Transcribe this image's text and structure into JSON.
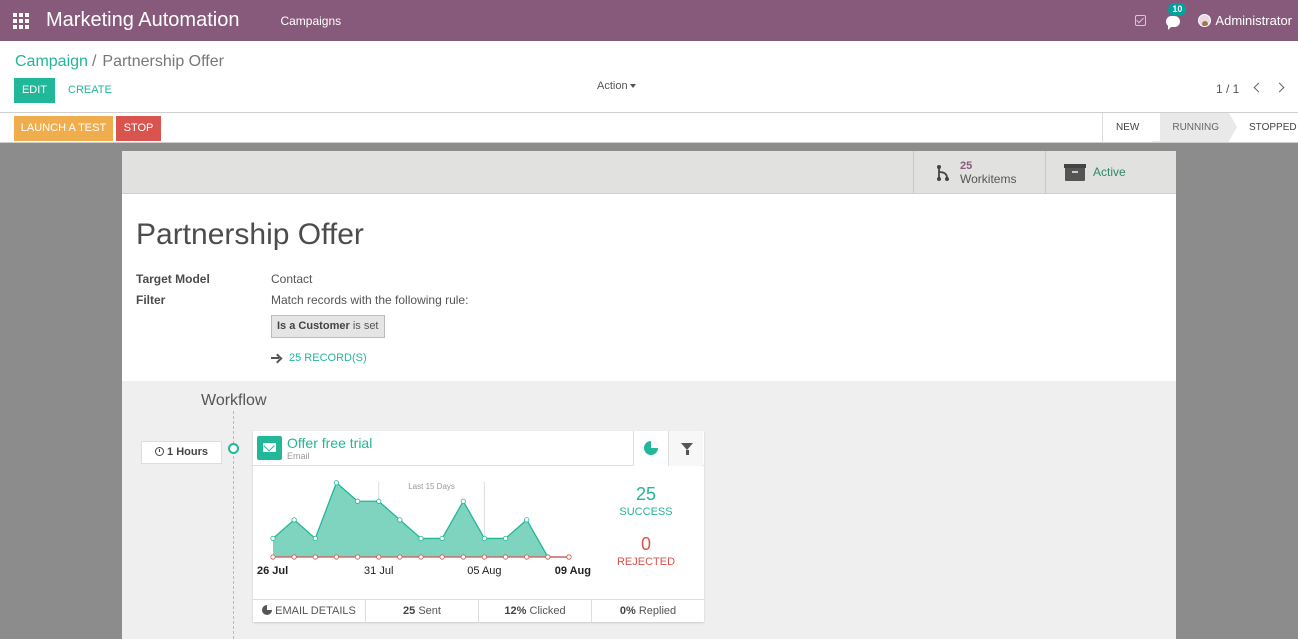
{
  "navbar": {
    "app_title": "Marketing Automation",
    "menu_campaigns": "Campaigns",
    "messages_badge": "10",
    "user_name": "Administrator"
  },
  "control": {
    "breadcrumb_parent": "Campaign",
    "breadcrumb_current": "Partnership Offer",
    "edit_label": "EDIT",
    "create_label": "CREATE",
    "action_label": "Action",
    "pager_text": "1 / 1"
  },
  "statusbar": {
    "launch_test_label": "LAUNCH A TEST",
    "stop_label": "STOP",
    "stages": [
      "NEW",
      "RUNNING",
      "STOPPED"
    ],
    "current_stage": "RUNNING"
  },
  "buttonbox": {
    "workitems_count": "25",
    "workitems_label": "Workitems",
    "active_label": "Active"
  },
  "record": {
    "title": "Partnership Offer",
    "target_model_label": "Target Model",
    "target_model_value": "Contact",
    "filter_label": "Filter",
    "filter_value": "Match records with the following rule:",
    "domain_field": "Is a Customer",
    "domain_operator": "is set",
    "records_link": "25 RECORD(S)"
  },
  "workflow": {
    "title": "Workflow",
    "interval_label": "1 Hours",
    "activity": {
      "name": "Offer free trial",
      "type": "Email",
      "success_count": "25",
      "success_label": "SUCCESS",
      "rejected_count": "0",
      "rejected_label": "REJECTED",
      "footer": {
        "details_label": "EMAIL DETAILS",
        "sent_value": "25",
        "sent_label": "Sent",
        "clicked_value": "12%",
        "clicked_label": "Clicked",
        "replied_value": "0%",
        "replied_label": "Replied"
      }
    }
  },
  "chart_data": {
    "type": "area",
    "annotation": "Last 15 Days",
    "x_tick_labels": [
      "26 Jul",
      "31 Jul",
      "05 Aug",
      "09 Aug"
    ],
    "series": [
      {
        "values": [
          1,
          2,
          1,
          4,
          3,
          3,
          2,
          1,
          1,
          3,
          1,
          1,
          2,
          0,
          0
        ],
        "color": "#21b799"
      },
      {
        "values": [
          0,
          0,
          0,
          0,
          0,
          0,
          0,
          0,
          0,
          0,
          0,
          0,
          0,
          0,
          0
        ],
        "color": "#d9534f"
      }
    ],
    "ylim": [
      0,
      4.2
    ],
    "grid": false,
    "colors": {
      "success_fill": "#7fd4c0",
      "success_line": "#21b799",
      "rejected": "#d9534f"
    }
  }
}
